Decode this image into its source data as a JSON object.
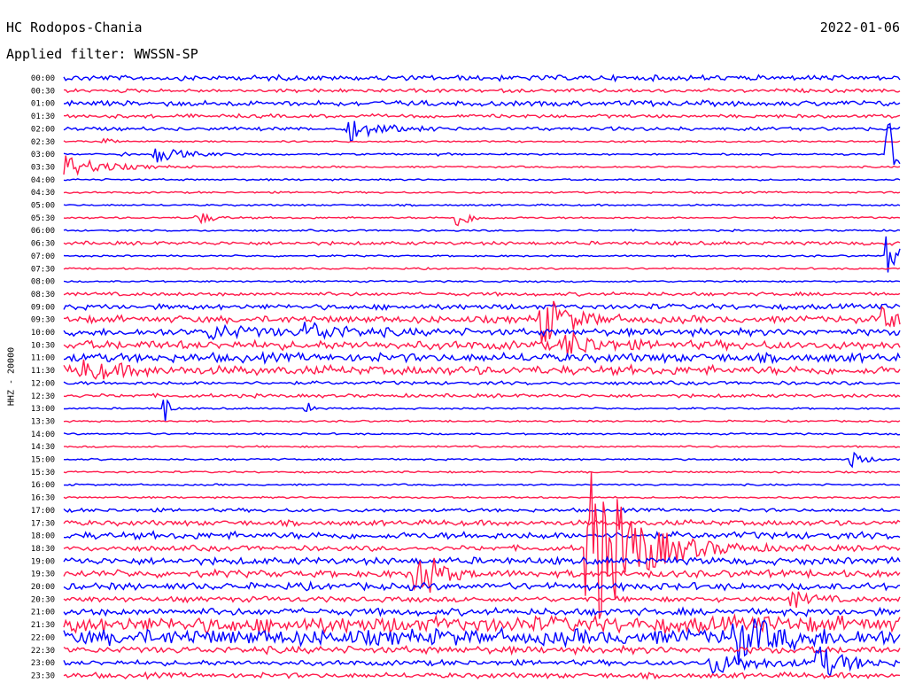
{
  "header": {
    "station": "HC Rodopos-Chania",
    "date": "2022-01-06",
    "filter": "Applied filter: WWSSN-SP"
  },
  "chart_data": {
    "type": "line",
    "title": "HC Rodopos-Chania",
    "ylabel": "HHZ - 20000",
    "colors": [
      "#0000ff",
      "#ff1a4b"
    ],
    "rows": [
      "00:00",
      "00:30",
      "01:00",
      "01:30",
      "02:00",
      "02:30",
      "03:00",
      "03:30",
      "04:00",
      "04:30",
      "05:00",
      "05:30",
      "06:00",
      "06:30",
      "07:00",
      "07:30",
      "08:00",
      "08:30",
      "09:00",
      "09:30",
      "10:00",
      "10:30",
      "11:00",
      "11:30",
      "12:00",
      "12:30",
      "13:00",
      "13:30",
      "14:00",
      "14:30",
      "15:00",
      "15:30",
      "16:00",
      "16:30",
      "17:00",
      "17:30",
      "18:00",
      "18:30",
      "19:00",
      "19:30",
      "20:00",
      "20:30",
      "21:00",
      "21:30",
      "22:00",
      "22:30",
      "23:00",
      "23:30"
    ],
    "noise_level": [
      3,
      2,
      3,
      2,
      2,
      1,
      1,
      1,
      1,
      1,
      1,
      1,
      1,
      2,
      1,
      1,
      1,
      2,
      3,
      4,
      4,
      5,
      5,
      5,
      2,
      2,
      1,
      1,
      1,
      1,
      1,
      1,
      1,
      1,
      2,
      3,
      4,
      3,
      4,
      4,
      4,
      3,
      4,
      9,
      9,
      4,
      3,
      3
    ],
    "events": [
      {
        "row": "02:00",
        "t": 0.34,
        "amp": 14,
        "dur": 0.03
      },
      {
        "row": "02:30",
        "t": 0.05,
        "amp": 8,
        "dur": 0.005
      },
      {
        "row": "03:00",
        "t": 0.11,
        "amp": 9,
        "dur": 0.03
      },
      {
        "row": "03:00",
        "t": 0.07,
        "amp": 4,
        "dur": 0.005
      },
      {
        "row": "03:00",
        "t": 0.45,
        "amp": 4,
        "dur": 0.005
      },
      {
        "row": "03:30",
        "t": 0.0,
        "amp": 14,
        "dur": 0.04
      },
      {
        "row": "03:00",
        "t": 0.985,
        "amp": 45,
        "dur": 0.02
      },
      {
        "row": "05:30",
        "t": 0.16,
        "amp": 8,
        "dur": 0.015
      },
      {
        "row": "05:30",
        "t": 0.47,
        "amp": 12,
        "dur": 0.015
      },
      {
        "row": "07:00",
        "t": 0.985,
        "amp": 22,
        "dur": 0.015
      },
      {
        "row": "09:30",
        "t": 0.57,
        "amp": 30,
        "dur": 0.03
      },
      {
        "row": "09:30",
        "t": 0.98,
        "amp": 10,
        "dur": 0.03
      },
      {
        "row": "10:30",
        "t": 0.6,
        "amp": 15,
        "dur": 0.03
      },
      {
        "row": "10:00",
        "t": 0.17,
        "amp": 8,
        "dur": 0.05
      },
      {
        "row": "10:00",
        "t": 0.29,
        "amp": 10,
        "dur": 0.04
      },
      {
        "row": "11:30",
        "t": 0.02,
        "amp": 10,
        "dur": 0.04
      },
      {
        "row": "13:00",
        "t": 0.12,
        "amp": 30,
        "dur": 0.004
      },
      {
        "row": "13:00",
        "t": 0.29,
        "amp": 12,
        "dur": 0.004
      },
      {
        "row": "15:00",
        "t": 0.94,
        "amp": 10,
        "dur": 0.015
      },
      {
        "row": "18:30",
        "t": 0.625,
        "amp": 110,
        "dur": 0.05
      },
      {
        "row": "19:30",
        "t": 0.42,
        "amp": 45,
        "dur": 0.02
      },
      {
        "row": "20:30",
        "t": 0.87,
        "amp": 10,
        "dur": 0.02
      },
      {
        "row": "22:00",
        "t": 0.8,
        "amp": 25,
        "dur": 0.04
      },
      {
        "row": "23:00",
        "t": 0.77,
        "amp": 12,
        "dur": 0.05
      },
      {
        "row": "23:00",
        "t": 0.9,
        "amp": 20,
        "dur": 0.03
      }
    ]
  }
}
